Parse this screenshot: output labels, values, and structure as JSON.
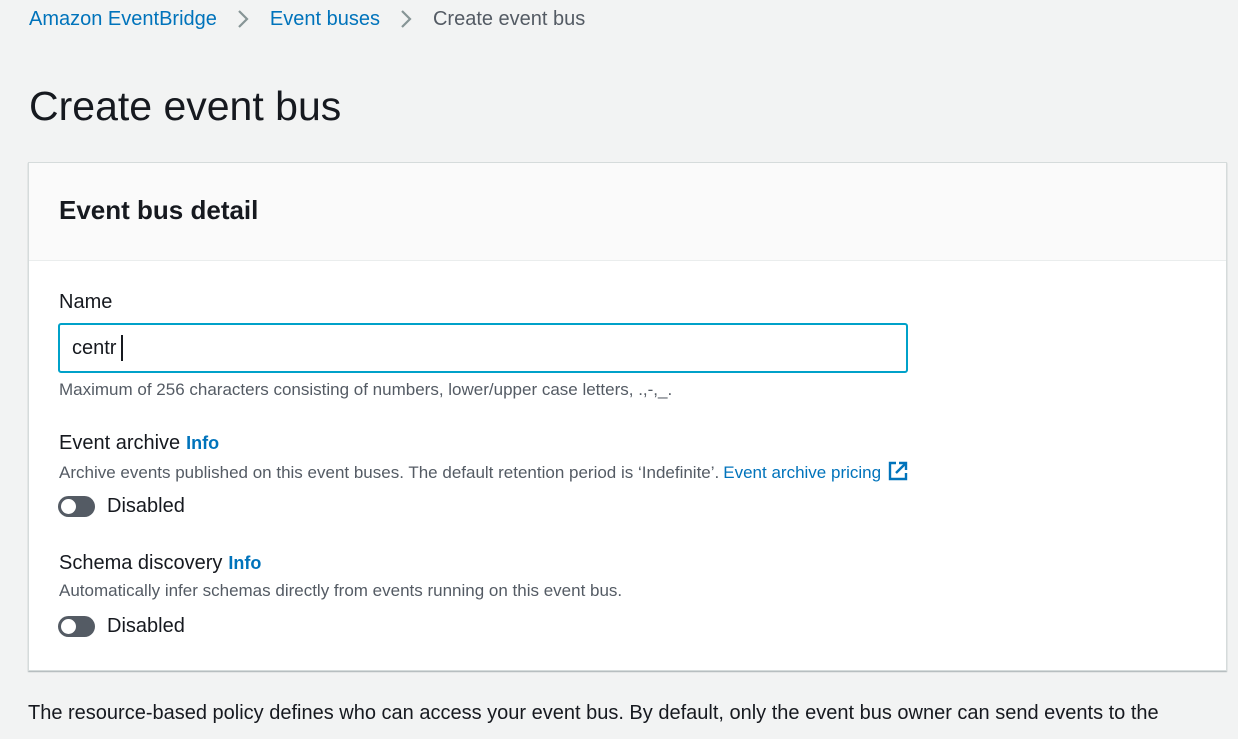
{
  "breadcrumb": {
    "items": [
      {
        "label": "Amazon EventBridge"
      },
      {
        "label": "Event buses"
      },
      {
        "label": "Create event bus"
      }
    ]
  },
  "page": {
    "title": "Create event bus"
  },
  "panel": {
    "title": "Event bus detail",
    "name_field": {
      "label": "Name",
      "value": "centr",
      "help": "Maximum of 256 characters consisting of numbers, lower/upper case letters, .,-,_."
    },
    "event_archive": {
      "label": "Event archive",
      "info": "Info",
      "description": "Archive events published on this event buses. The default retention period is ‘Indefinite’.",
      "link": "Event archive pricing",
      "toggle_label": "Disabled",
      "enabled": false
    },
    "schema_discovery": {
      "label": "Schema discovery",
      "info": "Info",
      "description": "Automatically infer schemas directly from events running on this event bus.",
      "toggle_label": "Disabled",
      "enabled": false
    }
  },
  "policy": {
    "text": "The resource-based policy defines who can access your event bus. By default, only the event bus owner can send events to the"
  },
  "colors": {
    "link": "#0073bb",
    "focus_border": "#00a1c9",
    "toggle_off": "#545b64",
    "background": "#f2f3f3"
  }
}
